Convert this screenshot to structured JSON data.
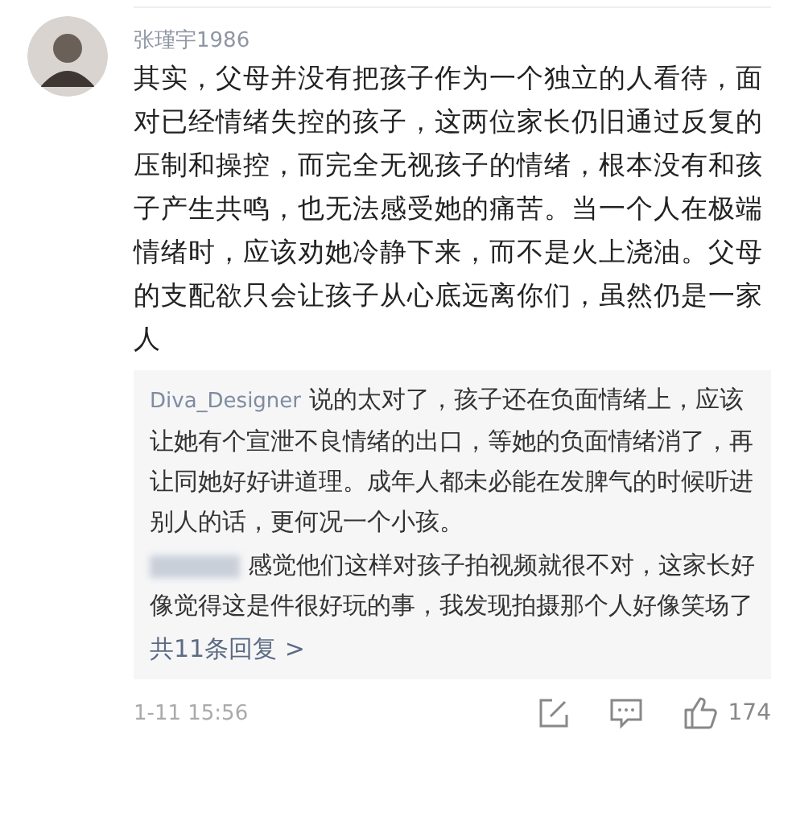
{
  "comment": {
    "username": "张瑾宇1986",
    "text": "其实，父母并没有把孩子作为一个独立的人看待，面对已经情绪失控的孩子，这两位家长仍旧通过反复的压制和操控，而完全无视孩子的情绪，根本没有和孩子产生共鸣，也无法感受她的痛苦。当一个人在极端情绪时，应该劝她冷静下来，而不是火上浇油。父母的支配欲只会让孩子从心底远离你们，虽然仍是一家人",
    "replies": [
      {
        "username": "Diva_Designer",
        "blurred": false,
        "text": "说的太对了，孩子还在负面情绪上，应该让她有个宣泄不良情绪的出口，等她的负面情绪消了，再让同她好好讲道理。成年人都未必能在发脾气的时候听进别人的话，更何况一个小孩。"
      },
      {
        "blurred": true,
        "text": "感觉他们这样对孩子拍视频就很不对，这家长好像觉得这是件很好玩的事，我发现拍摄那个人好像笑场了"
      }
    ],
    "more_replies": "共11条回复 >",
    "time": "1-11 15:56",
    "likes": "174"
  }
}
